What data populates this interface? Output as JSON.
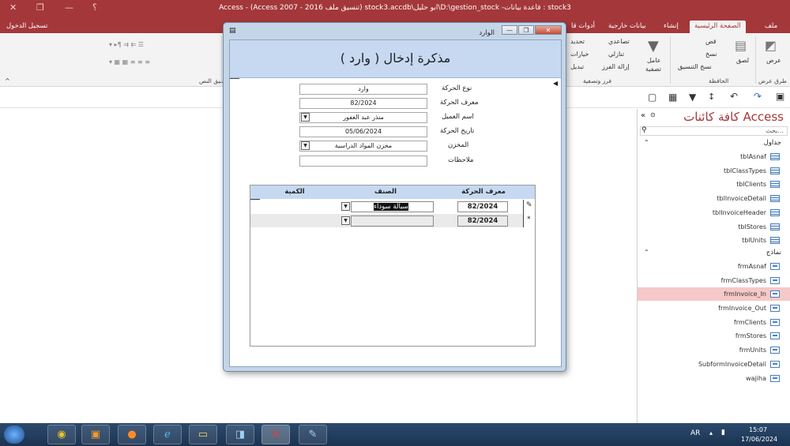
{
  "titlebar": {
    "title": "Access - (Access 2007 - 2016 تنسيق ملف) stock3.accdb\\ابو حليل\\D:\\gestion_stock -قاعدة بيانات : stock3",
    "help": "؟",
    "minimize": "—",
    "restore": "❐",
    "close": "✕"
  },
  "tabs": {
    "file": "ملف",
    "home": "الصفحة الرئيسية",
    "create": "إنشاء",
    "external": "بيانات خارجية",
    "tools": "أدوات قا",
    "signin": "تسجيل الدخول"
  },
  "ribbon": {
    "view": "عرض",
    "paste": "لصق",
    "cut": "قص",
    "copy": "نسخ",
    "format_painter": "نسخ التنسيق",
    "filter": "عامل",
    "filter2": "تصفية",
    "ascending": "تصاعدي",
    "descending": "تنازلي",
    "remove_sort": "إزالة الفرز",
    "selection": "تحديد",
    "advanced": "خيارات",
    "toggle": "تبديل",
    "g_views": "طرق عرض",
    "g_clipboard": "الحافظة",
    "g_sort": "فرز وتصفية",
    "g_text": "تنسيق النص"
  },
  "nav": {
    "title": "كافة كائنات Access",
    "search_placeholder": "بحث...",
    "tables_header": "جداول",
    "forms_header": "نماذج",
    "tables": [
      "tblAsnaf",
      "tblClassTypes",
      "tblClients",
      "tblInvoiceDetail",
      "tblInvoiceHeader",
      "tblStores",
      "tblUnits"
    ],
    "forms": [
      "frmAsnaf",
      "frmClassTypes",
      "frmInvoice_In",
      "frmInvoice_Out",
      "frmClients",
      "frmStores",
      "frmUnits",
      "SubformInvoiceDetail",
      "wajiha"
    ]
  },
  "dialog": {
    "title": "الوارد",
    "header": "مذكرة إدخال ( وارد )",
    "fields": {
      "type_label": "نوع الحركة",
      "type_value": "وارد",
      "id_label": "معرف الحركة",
      "id_value": "82/2024",
      "client_label": "اسم العميل",
      "client_value": "منذر عبد الغفور",
      "date_label": "تاريخ الحركة",
      "date_value": "05/06/2024",
      "store_label": "المخزن",
      "store_value": "مخزن المواد الدراسية",
      "notes_label": "ملاحظات",
      "notes_value": ""
    },
    "sub": {
      "col_id": "معرف الحركة",
      "col_item": "الصنف",
      "col_qty": "الكمية",
      "rows": [
        {
          "id": "82/2024",
          "item": "سبالة سوداء",
          "qty": ""
        },
        {
          "id": "82/2024",
          "item": "",
          "qty": ""
        }
      ]
    }
  },
  "taskbar": {
    "lang": "AR",
    "time": "15:07",
    "date": "17/06/2024"
  }
}
